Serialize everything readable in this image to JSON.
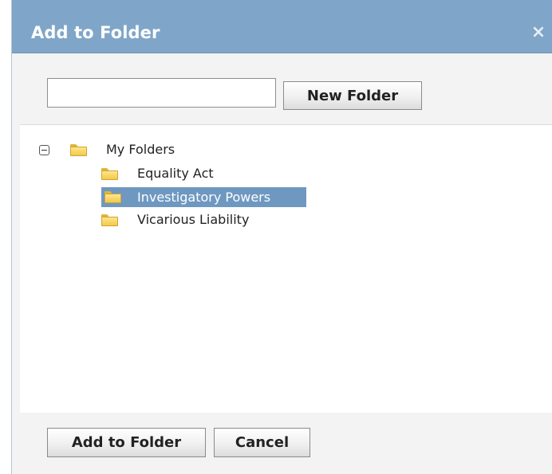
{
  "dialog": {
    "title": "Add to Folder",
    "close_icon": "close-icon"
  },
  "toolbar": {
    "search_value": "",
    "new_folder_label": "New Folder"
  },
  "tree": {
    "root_label": "My Folders",
    "root_expanded": true,
    "items": [
      {
        "label": "Equality Act",
        "selected": false
      },
      {
        "label": "Investigatory Powers",
        "selected": true
      },
      {
        "label": "Vicarious Liability",
        "selected": false
      }
    ]
  },
  "footer": {
    "add_label": "Add to Folder",
    "cancel_label": "Cancel"
  },
  "colors": {
    "titlebar": "#7fa6c8",
    "selection": "#6f98c1",
    "folder": "#f2c94c"
  }
}
